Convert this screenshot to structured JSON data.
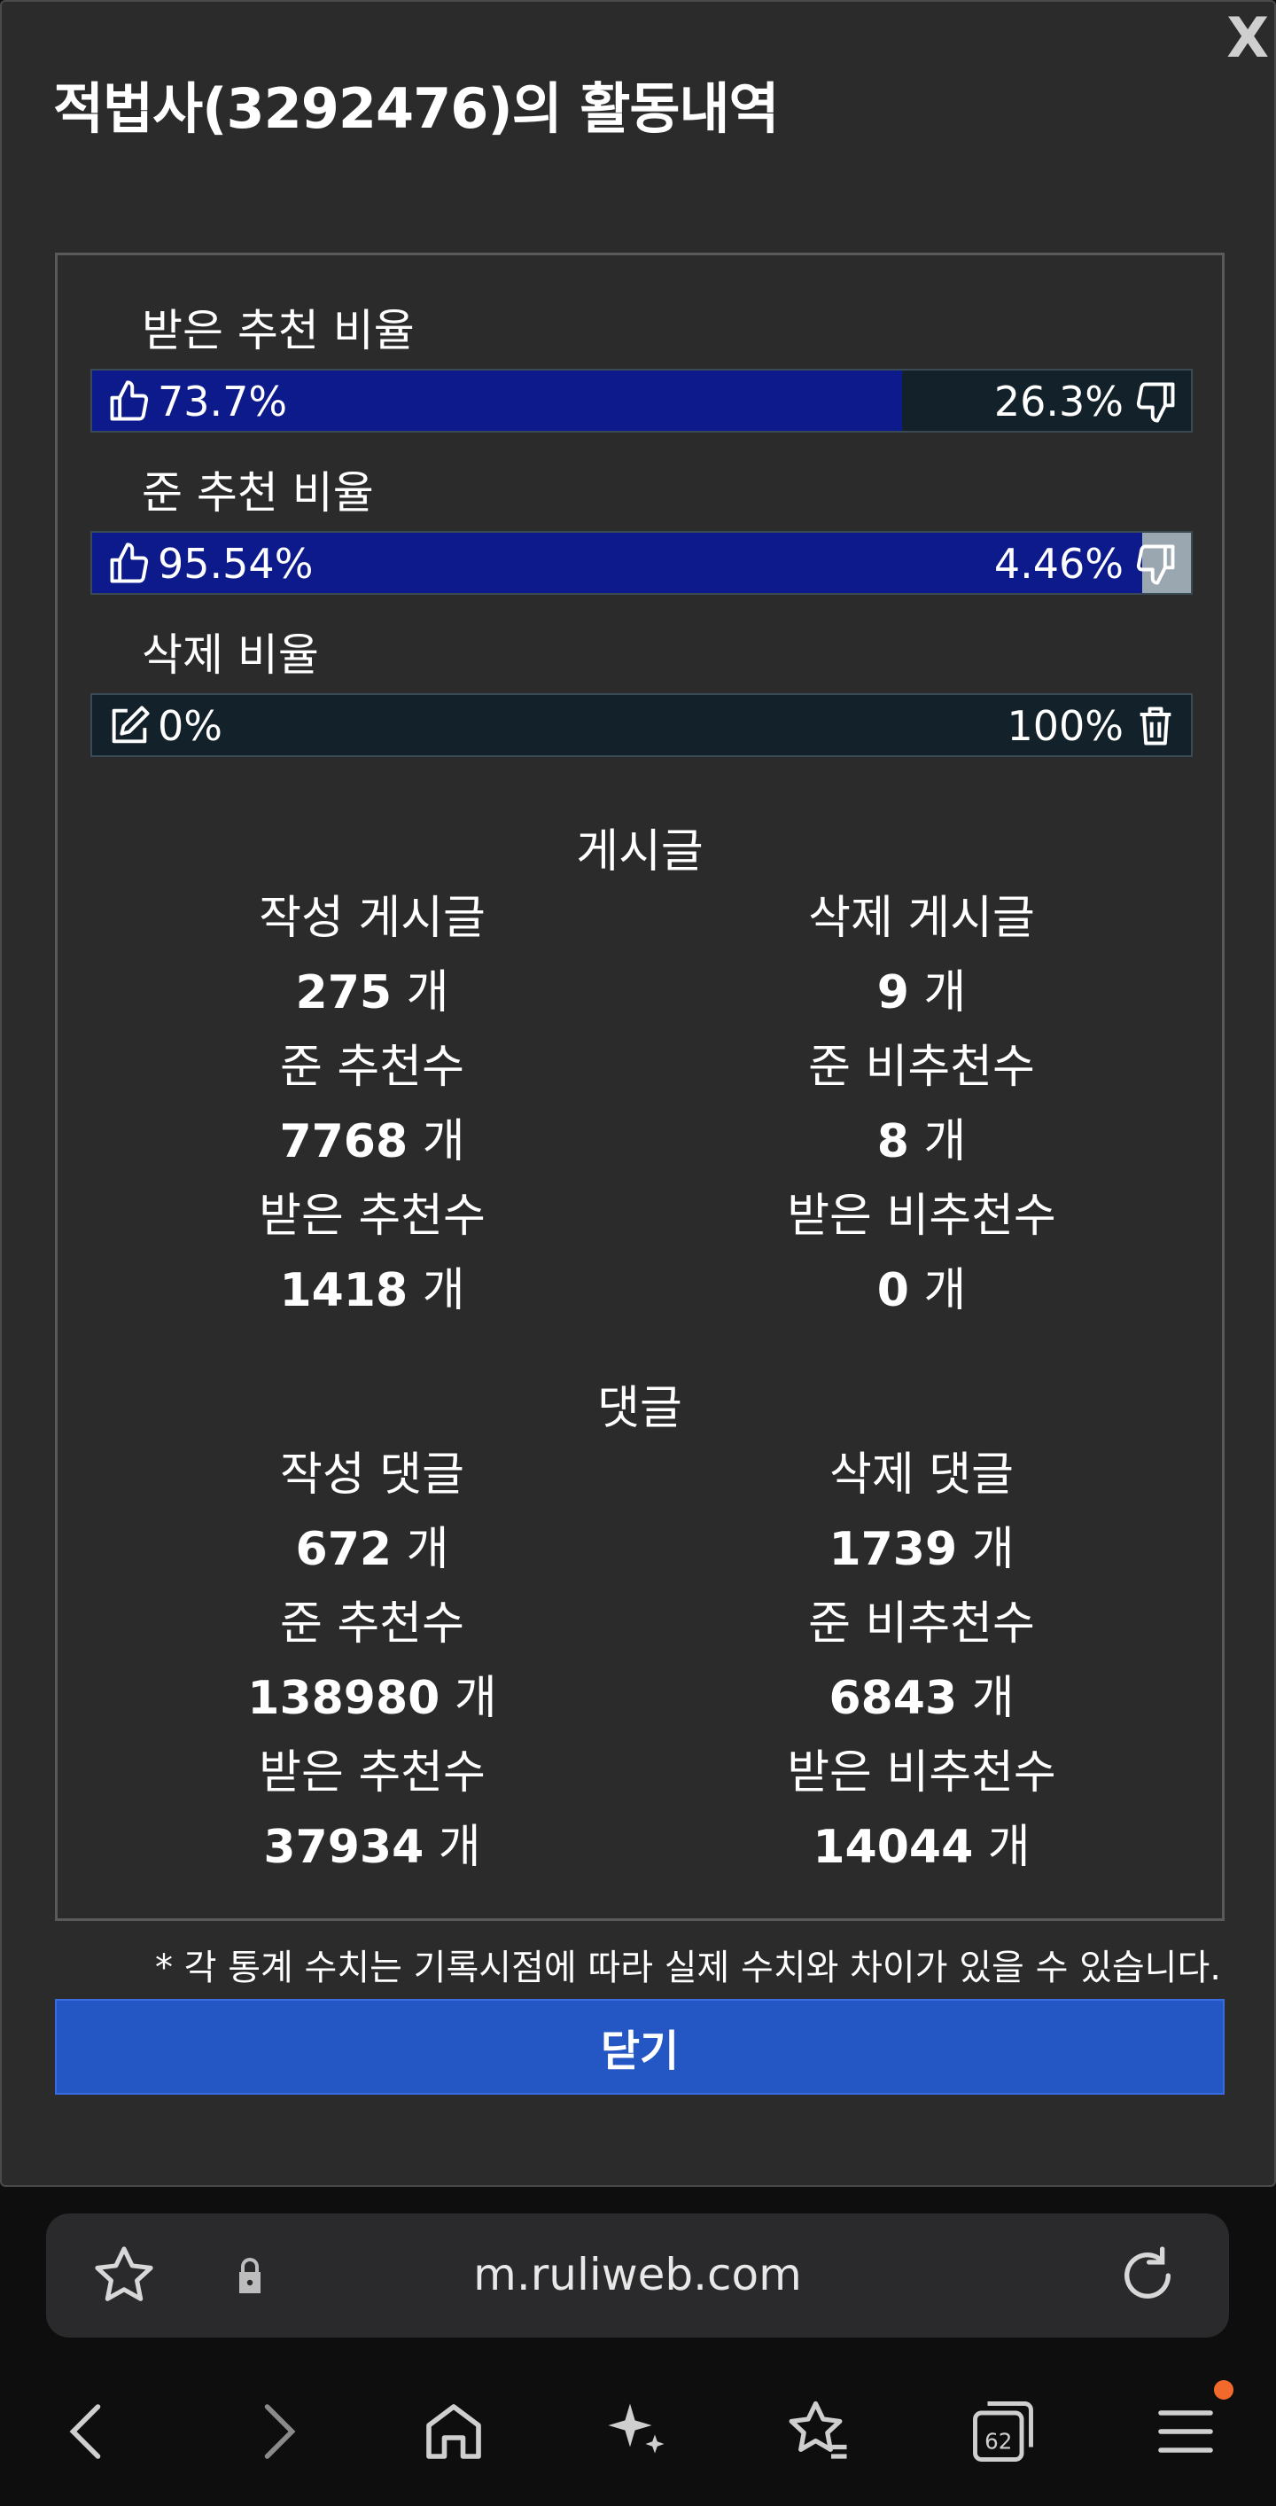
{
  "modal": {
    "title": "적법사(3292476)의 활동내역",
    "close_label": "X"
  },
  "ratios": [
    {
      "label": "받은 추천 비율",
      "left_text": "73.7%",
      "right_text": "26.3%",
      "fill_fraction": 0.737,
      "left_icon": "thumbs-up-icon",
      "right_icon": "thumbs-down-icon"
    },
    {
      "label": "준 추천 비율",
      "left_text": "95.54%",
      "right_text": "4.46%",
      "fill_fraction": 0.9554,
      "left_icon": "thumbs-up-icon",
      "right_icon": "thumbs-down-icon"
    },
    {
      "label": "삭제 비율",
      "left_text": "0%",
      "right_text": "100%",
      "fill_fraction": 0.0,
      "left_icon": "edit-icon",
      "right_icon": "trash-icon"
    }
  ],
  "posts": {
    "title": "게시글",
    "rows": [
      {
        "left_label": "작성 게시글",
        "left_value": "275",
        "right_label": "삭제 게시글",
        "right_value": "9"
      },
      {
        "left_label": "준 추천수",
        "left_value": "7768",
        "right_label": "준 비추천수",
        "right_value": "8"
      },
      {
        "left_label": "받은 추천수",
        "left_value": "1418",
        "right_label": "받은 비추천수",
        "right_value": "0"
      }
    ]
  },
  "comments": {
    "title": "댓글",
    "rows": [
      {
        "left_label": "작성 댓글",
        "left_value": "672",
        "right_label": "삭제 댓글",
        "right_value": "1739"
      },
      {
        "left_label": "준 추천수",
        "left_value": "138980",
        "right_label": "준 비추천수",
        "right_value": "6843"
      },
      {
        "left_label": "받은 추천수",
        "left_value": "37934",
        "right_label": "받은 비추천수",
        "right_value": "14044"
      }
    ]
  },
  "unit": "개",
  "note": "* 각 통계 수치는 기록시점에 따라 실제 수치와 차이가 있을 수 있습니다.",
  "close_button": "닫기",
  "browser": {
    "url": "m.ruliweb.com",
    "tab_count": "62"
  },
  "colors": {
    "bar_fill": "#0c1a8c",
    "button": "#2456c4",
    "notification_dot": "#f26a2b"
  }
}
